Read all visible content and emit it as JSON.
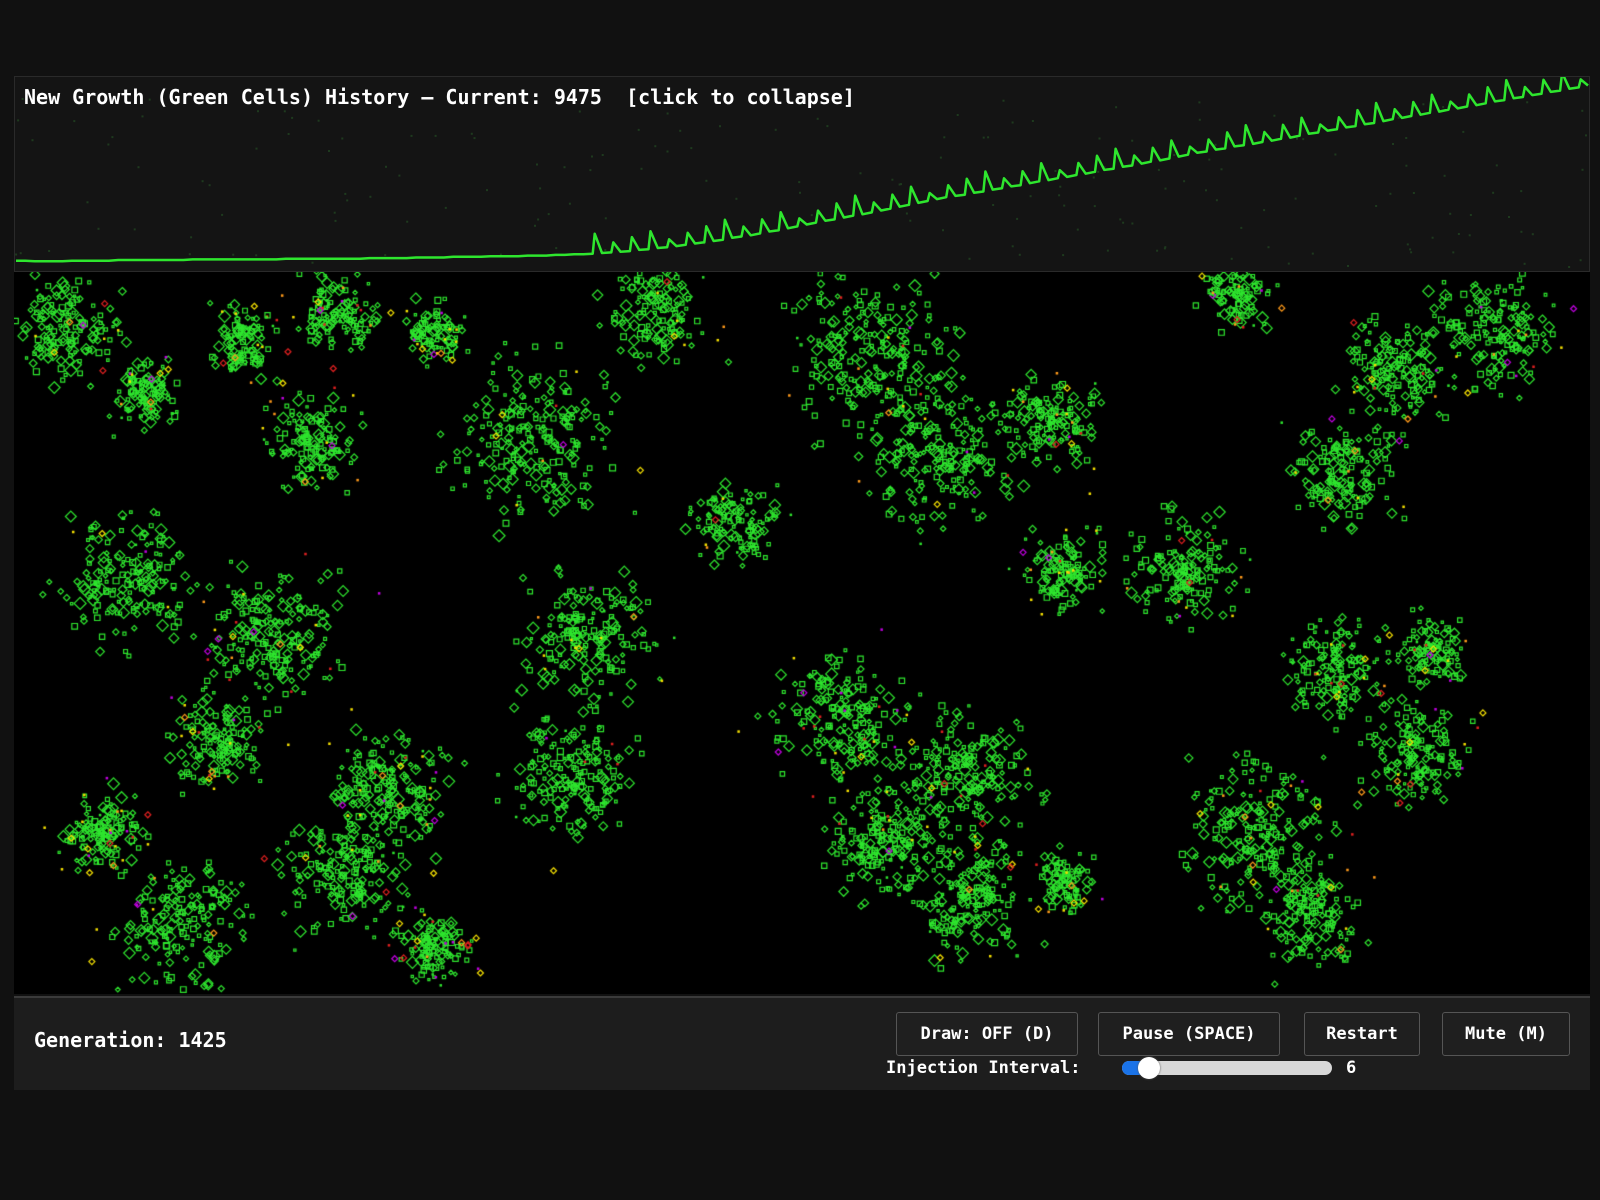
{
  "history": {
    "title_prefix": "New Growth (Green Cells) History — Current: ",
    "current": "9475",
    "collapse_hint": "[click to collapse]",
    "line_color": "#2ee62e",
    "values": [
      100,
      100,
      99,
      99,
      99,
      99,
      100,
      100,
      100,
      100,
      100,
      101,
      101,
      101,
      101,
      101,
      101,
      101,
      101,
      102,
      102,
      102,
      102,
      102,
      102,
      102,
      102,
      102,
      102,
      103,
      103,
      103,
      103,
      103,
      103,
      103,
      103,
      103,
      104,
      104,
      104,
      104,
      104,
      105,
      105,
      105,
      105,
      106,
      106,
      106,
      106,
      107,
      107,
      107,
      107,
      108,
      108,
      108,
      109,
      109,
      110,
      110,
      111,
      112,
      113,
      114,
      115,
      117,
      118,
      120,
      121,
      123,
      125,
      127,
      129,
      131,
      133,
      136,
      138,
      140,
      143,
      146,
      148,
      151,
      154,
      157,
      160,
      163,
      165,
      168,
      171,
      173,
      176,
      179,
      182,
      185,
      188,
      191,
      194,
      197,
      200,
      202,
      204,
      207,
      209,
      212,
      214,
      217,
      219,
      222,
      225,
      227,
      230,
      232,
      235,
      237,
      240,
      243,
      245,
      248,
      250,
      253,
      256,
      258,
      261,
      264,
      267,
      270,
      272,
      275,
      277,
      280,
      282,
      284,
      287,
      289,
      292,
      294,
      297,
      300,
      302,
      305,
      307,
      310,
      312,
      315,
      317,
      320,
      323,
      325,
      328,
      330,
      333,
      335,
      338,
      340,
      343,
      345,
      348,
      351,
      353,
      356,
      358,
      361,
      363,
      366,
      368,
      371,
      373,
      376
    ]
  },
  "grid": {
    "green": "#2ee62e",
    "yellow": "#f5e000",
    "orange": "#ff9a1a",
    "red": "#e02020",
    "magenta": "#c000e0"
  },
  "controls": {
    "generation_label": "Generation: ",
    "generation_value": "1425",
    "draw_label": "Draw: OFF (D)",
    "pause_label": "Pause (SPACE)",
    "restart_label": "Restart",
    "mute_label": "Mute (M)",
    "injection_label": "Injection Interval:",
    "injection_value": "6",
    "injection_min": 1,
    "injection_max": 60,
    "slider_color": "#1a73e8"
  }
}
